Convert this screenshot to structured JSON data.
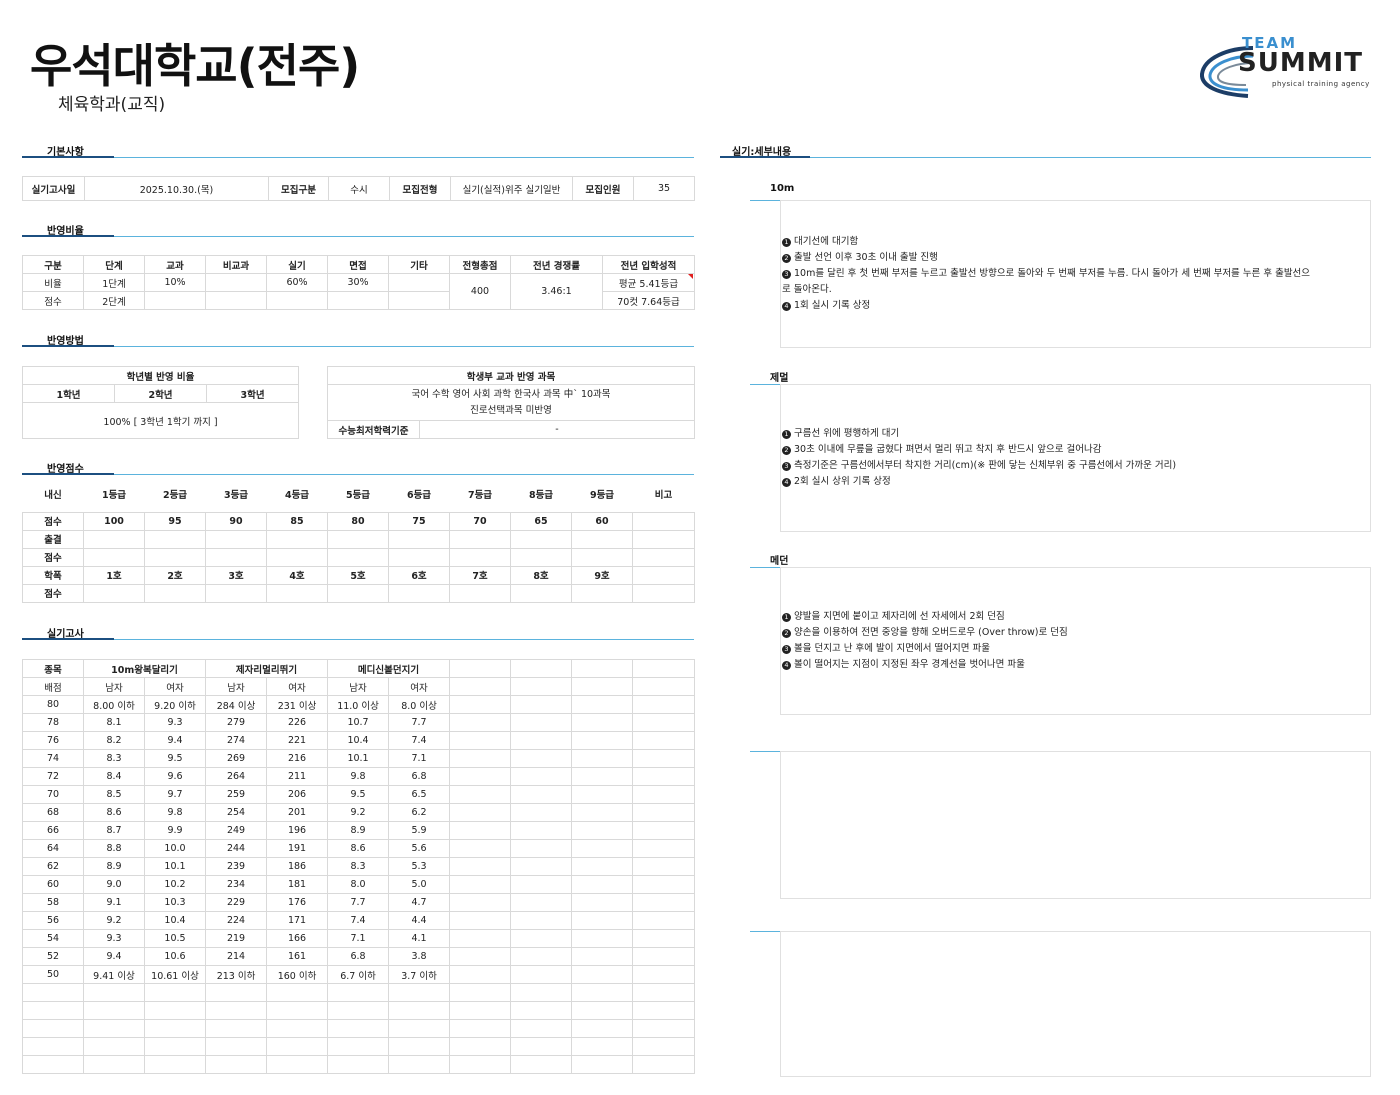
{
  "header": {
    "title": "우석대학교(전주)",
    "subtitle": "체육학과(교직)"
  },
  "logo": {
    "team": "TEAM",
    "summit": "SUMMIT",
    "tagline": "physical training agency",
    "accent": "#3a8fcf"
  },
  "basic": {
    "heading": "기본사항",
    "exam_date_label": "실기고사일",
    "exam_date": "2025.10.30.(목)",
    "type_label": "모집구분",
    "type": "수시",
    "track_label": "모집전형",
    "track": "실기(실적)위주 실기일반",
    "quota_label": "모집인원",
    "quota": "35"
  },
  "ratio": {
    "heading": "반영비율",
    "headers": [
      "구분",
      "단계",
      "교과",
      "비교과",
      "실기",
      "면접",
      "기타",
      "전형총점",
      "전년 경쟁률",
      "전년 입학성적"
    ],
    "row1": [
      "비율",
      "1단계",
      "10%",
      "",
      "60%",
      "30%",
      ""
    ],
    "row2": [
      "점수",
      "2단계",
      "",
      "",
      "",
      "",
      ""
    ],
    "total": "400",
    "competition": "3.46:1",
    "prev_score_1": "평균 5.41등급",
    "prev_score_2": "70컷 7.64등급"
  },
  "method": {
    "heading": "반영방법",
    "grade_title": "학년별 반영 비율",
    "grades": [
      "1학년",
      "2학년",
      "3학년"
    ],
    "grade_value": "100% [ 3학년 1학기 까지 ]",
    "subject_title": "학생부 교과 반영 과목",
    "subject_line1": "국어 수학 영어 사회 과학 한국사 과목 中` 10과목",
    "subject_line2": "진로선택과목 미반영",
    "min_label": "수능최저학력기준",
    "min_value": "-"
  },
  "scores": {
    "heading": "반영점수",
    "headers": [
      "내신",
      "1등급",
      "2등급",
      "3등급",
      "4등급",
      "5등급",
      "6등급",
      "7등급",
      "8등급",
      "9등급",
      "비고"
    ],
    "rows": [
      [
        "점수",
        "100",
        "95",
        "90",
        "85",
        "80",
        "75",
        "70",
        "65",
        "60",
        ""
      ],
      [
        "출결",
        "",
        "",
        "",
        "",
        "",
        "",
        "",
        "",
        "",
        ""
      ],
      [
        "점수",
        "",
        "",
        "",
        "",
        "",
        "",
        "",
        "",
        "",
        ""
      ],
      [
        "학폭",
        "1호",
        "2호",
        "3호",
        "4호",
        "5호",
        "6호",
        "7호",
        "8호",
        "9호",
        ""
      ],
      [
        "점수",
        "",
        "",
        "",
        "",
        "",
        "",
        "",
        "",
        "",
        ""
      ]
    ]
  },
  "practical": {
    "heading": "실기고사",
    "event_label": "종목",
    "events": [
      "10m왕복달리기",
      "제자리멀리뛰기",
      "메디신볼던지기"
    ],
    "score_label": "배점",
    "genders": [
      "남자",
      "여자",
      "남자",
      "여자",
      "남자",
      "여자"
    ],
    "rows": [
      [
        "80",
        "8.00 이하",
        "9.20 이하",
        "284 이상",
        "231 이상",
        "11.0 이상",
        "8.0 이상"
      ],
      [
        "78",
        "8.1",
        "9.3",
        "279",
        "226",
        "10.7",
        "7.7"
      ],
      [
        "76",
        "8.2",
        "9.4",
        "274",
        "221",
        "10.4",
        "7.4"
      ],
      [
        "74",
        "8.3",
        "9.5",
        "269",
        "216",
        "10.1",
        "7.1"
      ],
      [
        "72",
        "8.4",
        "9.6",
        "264",
        "211",
        "9.8",
        "6.8"
      ],
      [
        "70",
        "8.5",
        "9.7",
        "259",
        "206",
        "9.5",
        "6.5"
      ],
      [
        "68",
        "8.6",
        "9.8",
        "254",
        "201",
        "9.2",
        "6.2"
      ],
      [
        "66",
        "8.7",
        "9.9",
        "249",
        "196",
        "8.9",
        "5.9"
      ],
      [
        "64",
        "8.8",
        "10.0",
        "244",
        "191",
        "8.6",
        "5.6"
      ],
      [
        "62",
        "8.9",
        "10.1",
        "239",
        "186",
        "8.3",
        "5.3"
      ],
      [
        "60",
        "9.0",
        "10.2",
        "234",
        "181",
        "8.0",
        "5.0"
      ],
      [
        "58",
        "9.1",
        "10.3",
        "229",
        "176",
        "7.7",
        "4.7"
      ],
      [
        "56",
        "9.2",
        "10.4",
        "224",
        "171",
        "7.4",
        "4.4"
      ],
      [
        "54",
        "9.3",
        "10.5",
        "219",
        "166",
        "7.1",
        "4.1"
      ],
      [
        "52",
        "9.4",
        "10.6",
        "214",
        "161",
        "6.8",
        "3.8"
      ],
      [
        "50",
        "9.41 이상",
        "10.61 이상",
        "213 이하",
        "160 이하",
        "6.7 이하",
        "3.7 이하"
      ]
    ]
  },
  "details": {
    "heading": "실기:세부내용",
    "items": [
      {
        "title": "10m",
        "lines": [
          "대기선에 대기함",
          "출발 선언 이후 30초 이내 출발 진행",
          "10m를 달린 후 첫 번째 부저를 누르고 출발선 방향으로 돌아와 두 번째 부저를 누름. 다시 돌아가 세 번째 부저를 누른 후 출발선으",
          "1회 실시 기록 상정"
        ],
        "wrap": "로 돌아온다."
      },
      {
        "title": "제멀",
        "lines": [
          "구름선 위에 평행하게 대기",
          "30초 이내에 무릎을 굽혔다 펴면서 멀리 뛰고 착지 후 반드시 앞으로 걸어나감",
          "측정기준은 구름선에서부터 착지한 거리(cm)(※ 판에 닿는 신체부위 중 구름선에서 가까운 거리)",
          "2회 실시 상위 기록 상정"
        ]
      },
      {
        "title": "메던",
        "lines": [
          "양발을 지면에 붙이고 제자리에 선 자세에서 2회 던짐",
          "양손을 이용하여 전면 중앙을 향해 오버드로우 (Over throw)로 던짐",
          "볼을 던지고 난 후에 발이 지면에서 떨어지면 파울",
          "볼이 떨어지는 지점이 지정된 좌우 경계선을 벗어나면 파울"
        ]
      }
    ]
  }
}
